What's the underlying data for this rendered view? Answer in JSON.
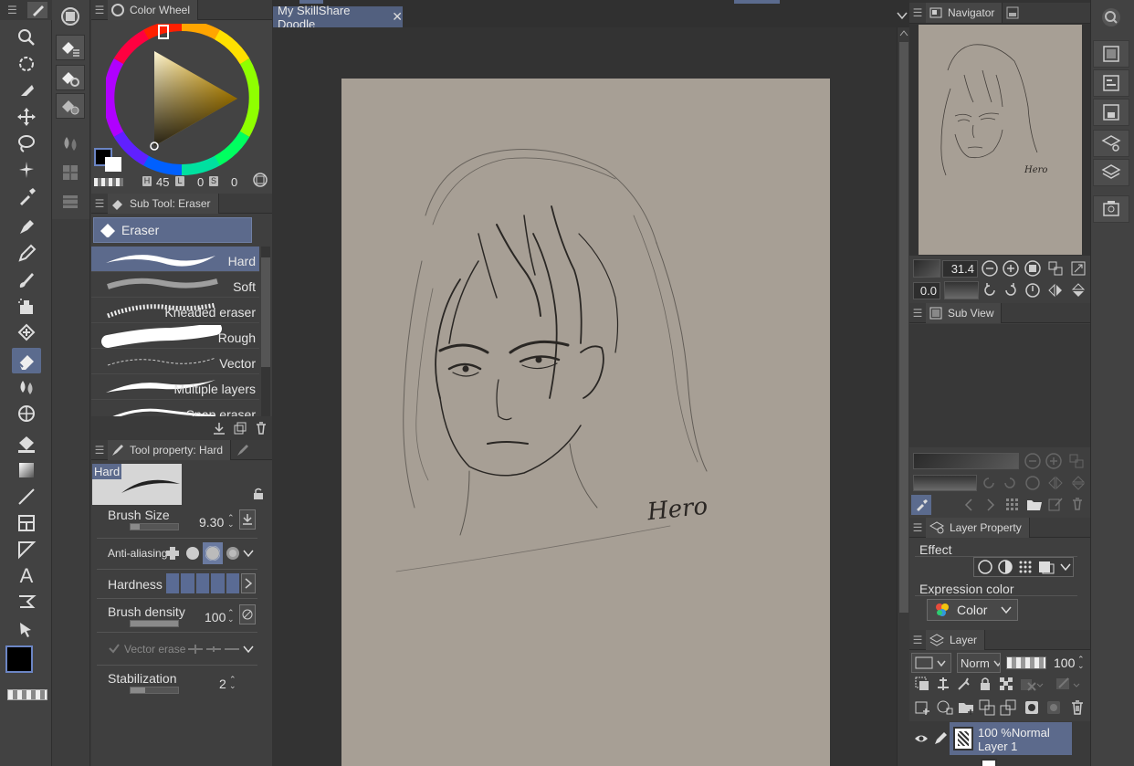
{
  "document": {
    "tab_title": "My SkillShare Doodle"
  },
  "panels": {
    "color_wheel": "Color Wheel",
    "sub_tool": "Sub Tool: Eraser",
    "tool_property": "Tool property: Hard",
    "navigator": "Navigator",
    "sub_view": "Sub View",
    "layer_property": "Layer Property",
    "layer": "Layer"
  },
  "color_wheel": {
    "h_label": "H",
    "h_value": "45",
    "l_label": "L",
    "l_value": "0",
    "s_label": "S",
    "s_value": "0",
    "hue_color": "#f7b500"
  },
  "sub_tool": {
    "group_name": "Eraser",
    "items": [
      "Hard",
      "Soft",
      "Kneaded eraser",
      "Rough",
      "Vector",
      "Multiple layers",
      "Snap eraser"
    ],
    "selected": "Hard"
  },
  "tool_property": {
    "preview_label": "Hard",
    "brush_size_label": "Brush Size",
    "brush_size_value": "9.30",
    "anti_aliasing_label": "Anti-aliasing",
    "hardness_label": "Hardness",
    "brush_density_label": "Brush density",
    "brush_density_value": "100",
    "vector_erase_label": "Vector erase",
    "stabilization_label": "Stabilization",
    "stabilization_value": "2"
  },
  "navigator": {
    "zoom": "31.4",
    "rotation": "0.0"
  },
  "layer_property": {
    "effect_label": "Effect",
    "expression_color_label": "Expression color",
    "expression_color_value": "Color"
  },
  "layer": {
    "blend_mode": "Norm",
    "opacity": "100",
    "layers": [
      {
        "info": "100 %Normal",
        "name": "Layer 1"
      }
    ]
  },
  "signature_text": "Hero",
  "colors": {
    "accent": "#5b6b8e",
    "paper": "#a79f95",
    "main_color": "#000000",
    "sub_color": "#ffffff"
  }
}
